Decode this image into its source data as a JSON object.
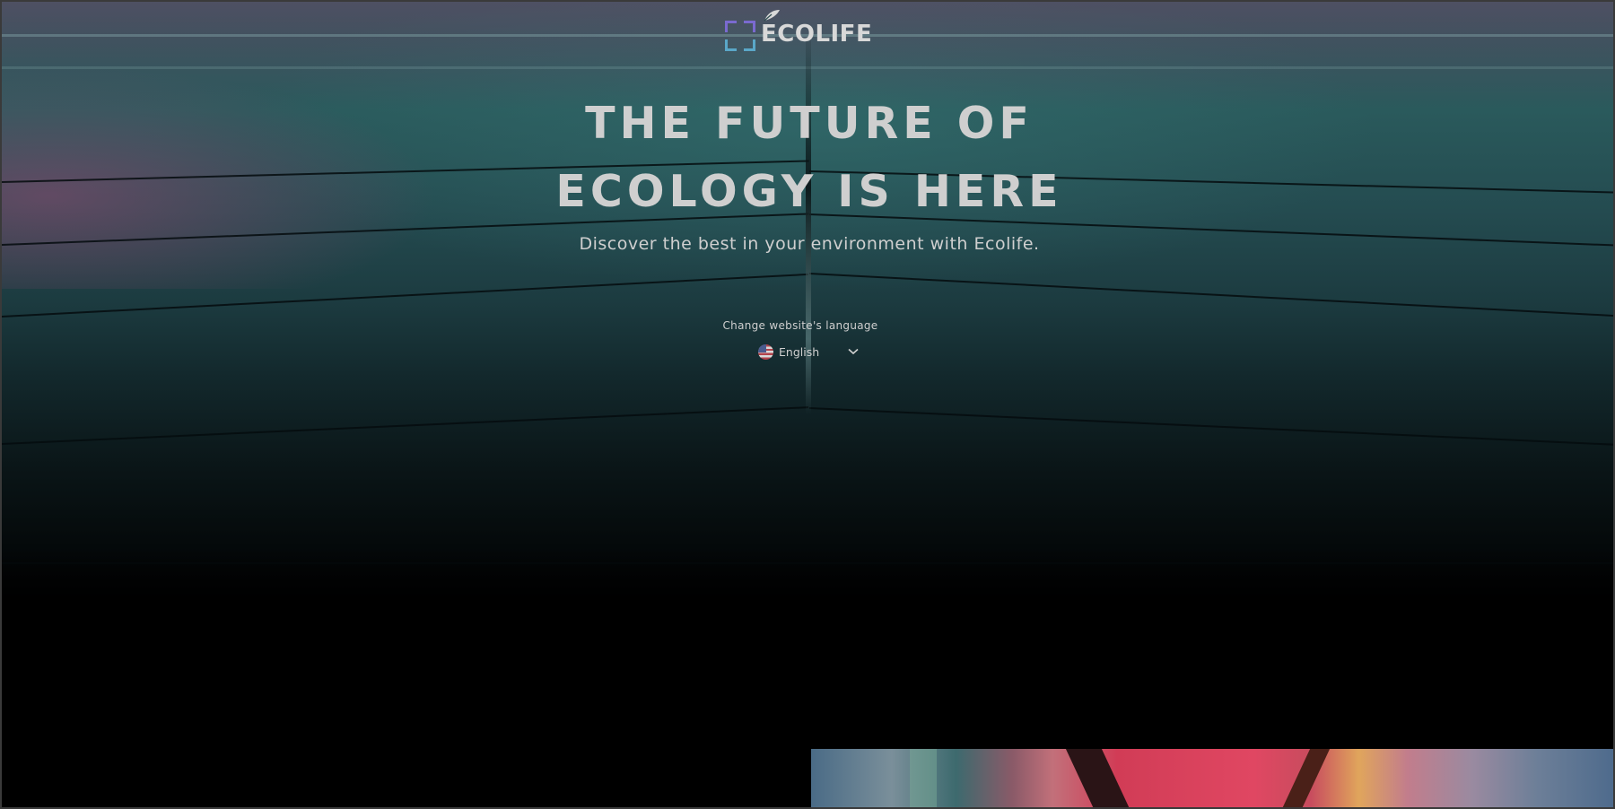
{
  "brand": {
    "name": "ECOLIFE"
  },
  "hero": {
    "title_line1": "THE FUTURE OF",
    "title_line2": "ECOLOGY IS HERE",
    "subtitle": "Discover the best in your environment with Ecolife."
  },
  "language": {
    "label": "Change website's language",
    "selected": "English",
    "flag": "us-flag-icon"
  },
  "colors": {
    "logo_accent_top": "#7a6ad0",
    "logo_accent_bottom": "#5aa7c8",
    "text": "#cfcfcf",
    "background": "#000000"
  }
}
